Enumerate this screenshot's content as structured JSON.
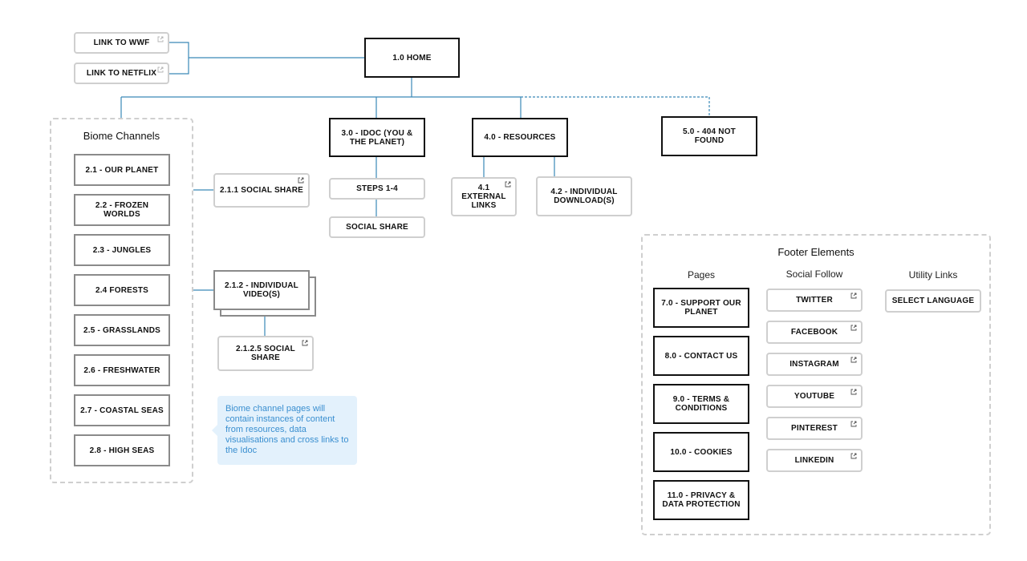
{
  "diagram": {
    "external_links": [
      {
        "label": "LINK TO WWF",
        "icon": "external-link-icon"
      },
      {
        "label": "LINK TO NETFLIX",
        "icon": "external-link-icon"
      }
    ],
    "home": {
      "label": "1.0 HOME"
    },
    "biome_channels": {
      "title": "Biome Channels",
      "items": [
        "2.1 - OUR PLANET",
        "2.2 - FROZEN WORLDS",
        "2.3 - JUNGLES",
        "2.4 FORESTS",
        "2.5 - GRASSLANDS",
        "2.6 - FRESHWATER",
        "2.7 - COASTAL SEAS",
        "2.8 - HIGH SEAS"
      ],
      "social_share": {
        "label": "2.1.1 SOCIAL SHARE",
        "icon": "external-link-icon"
      },
      "individual_videos": {
        "label": "2.1.2 - INDIVIDUAL VIDEO(S)"
      },
      "video_social_share": {
        "label": "2.1.2.5 SOCIAL SHARE",
        "icon": "external-link-icon"
      },
      "note": "Biome channel pages will contain instances of content from resources, data visualisations and cross links to the Idoc"
    },
    "idoc": {
      "label": "3.0 - IDOC (YOU & THE PLANET)",
      "children": [
        "STEPS 1-4",
        "SOCIAL SHARE"
      ]
    },
    "resources": {
      "label": "4.0 - RESOURCES",
      "children": [
        {
          "label": "4.1 EXTERNAL LINKS",
          "icon": "external-link-icon"
        },
        {
          "label": "4.2 - INDIVIDUAL DOWNLOAD(S)"
        }
      ]
    },
    "not_found": {
      "label": "5.0 - 404 NOT FOUND"
    },
    "footer": {
      "title": "Footer Elements",
      "columns": {
        "pages": {
          "title": "Pages",
          "items": [
            "7.0 - SUPPORT OUR PLANET",
            "8.0 - CONTACT US",
            "9.0 - TERMS & CONDITIONS",
            "10.0 - COOKIES",
            "11.0 - PRIVACY & DATA PROTECTION"
          ]
        },
        "social_follow": {
          "title": "Social Follow",
          "items": [
            "TWITTER",
            "FACEBOOK",
            "INSTAGRAM",
            "YOUTUBE",
            "PINTEREST",
            "LINKEDIN"
          ]
        },
        "utility_links": {
          "title": "Utility Links",
          "items": [
            "SELECT LANGUAGE"
          ]
        }
      }
    },
    "colors": {
      "connector": "#3a89b8",
      "primary_border": "#111111",
      "channel_border": "#8a8a8a",
      "link_border": "#cfcfcf",
      "note_bg": "#e3f1fc",
      "note_text": "#3a8fd0"
    }
  }
}
